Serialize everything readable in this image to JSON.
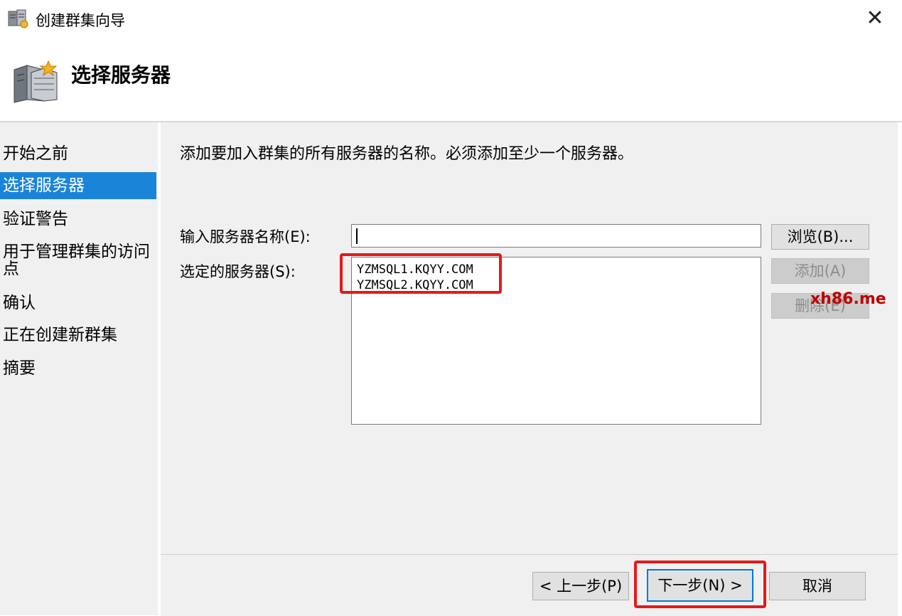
{
  "window": {
    "title": "创建群集向导",
    "close_glyph": "✕"
  },
  "header": {
    "title": "选择服务器"
  },
  "nav": {
    "items": [
      {
        "label": "开始之前"
      },
      {
        "label": "选择服务器",
        "selected": true
      },
      {
        "label": "验证警告"
      },
      {
        "label": "用于管理群集的访问点"
      },
      {
        "label": "确认"
      },
      {
        "label": "正在创建新群集"
      },
      {
        "label": "摘要"
      }
    ]
  },
  "main": {
    "description": "添加要加入群集的所有服务器的名称。必须添加至少一个服务器。",
    "server_name_label": "输入服务器名称(E):",
    "server_name_value": "",
    "selected_label": "选定的服务器(S):",
    "selected_servers": [
      "YZMSQL1.KQYY.COM",
      "YZMSQL2.KQYY.COM"
    ],
    "browse_button": "浏览(B)...",
    "add_button": "添加(A)",
    "remove_button": "删除(E)"
  },
  "footer": {
    "back_button": "< 上一步(P)",
    "next_button": "下一步(N) >",
    "cancel_button": "取消"
  },
  "watermark": "xh86.me",
  "icons": {
    "app": "cluster-server-icon",
    "header": "server-rack-icon",
    "close": "close-icon"
  },
  "colors": {
    "nav_selected": "#1a84d8",
    "highlight_box": "#e21a1a",
    "default_button_border": "#0078d7"
  }
}
